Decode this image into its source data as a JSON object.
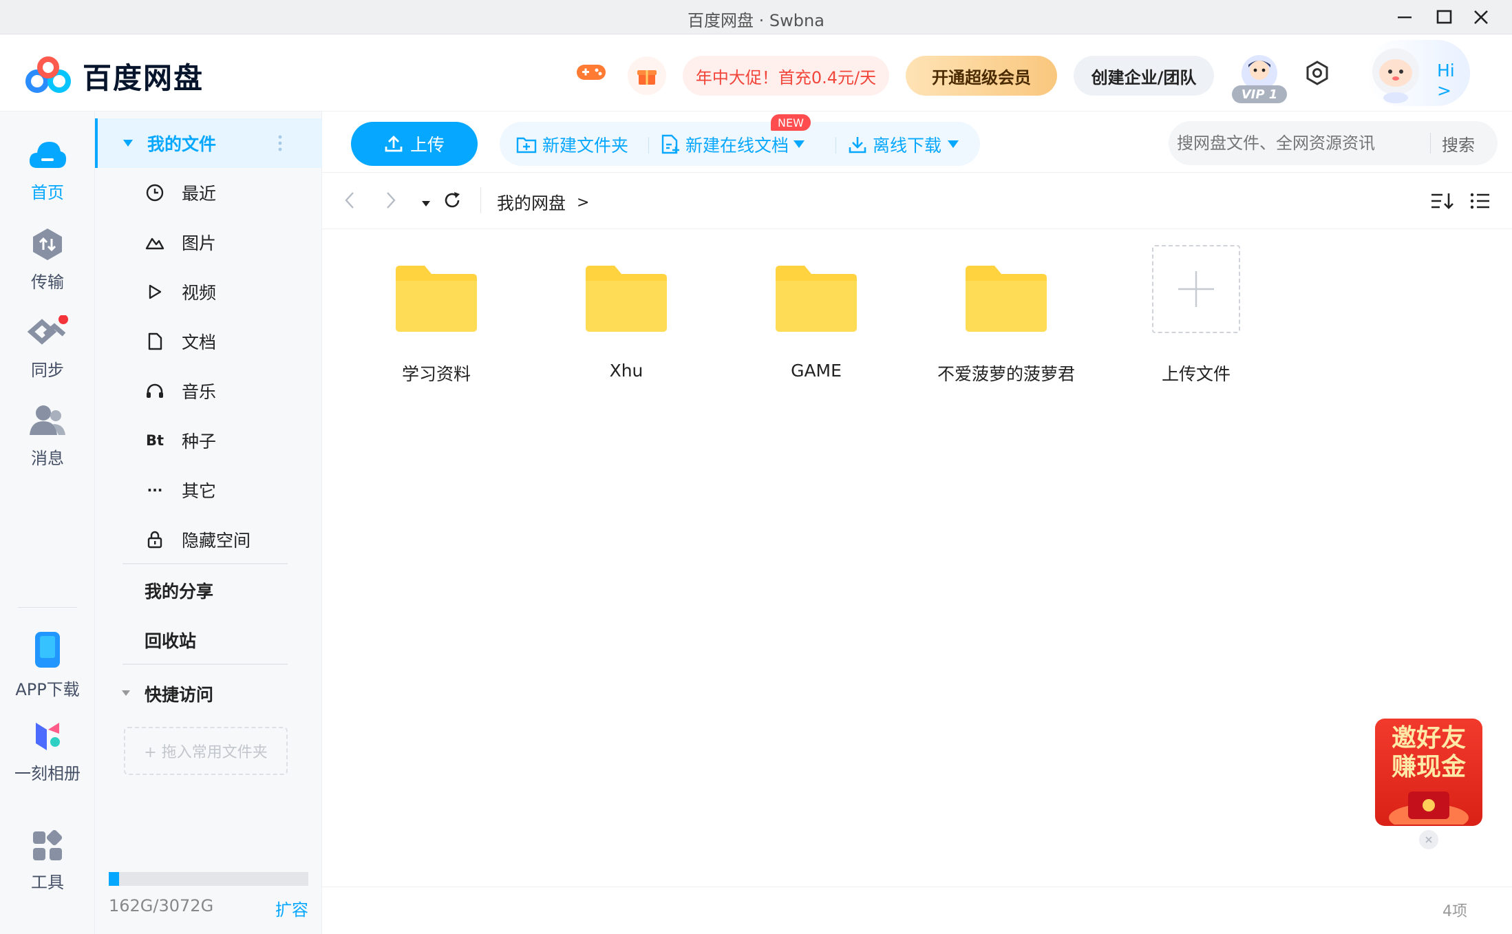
{
  "window": {
    "title": "百度网盘 · Swbna"
  },
  "header": {
    "logo_text": "百度网盘",
    "icons": [
      "gamepad-icon",
      "gift-icon",
      "settings-icon",
      "assistant-avatar"
    ],
    "promo_label": "年中大促！首充0.4元/天",
    "vip_button": "开通超级会员",
    "enterprise_button": "创建企业/团队",
    "vip_badge": "VIP 1",
    "hi_label": "Hi >"
  },
  "rail": {
    "items": [
      {
        "label": "首页",
        "icon": "cloud-icon"
      },
      {
        "label": "传输",
        "icon": "transfer-icon"
      },
      {
        "label": "同步",
        "icon": "sync-icon"
      },
      {
        "label": "消息",
        "icon": "message-icon"
      },
      {
        "label": "APP下载",
        "icon": "phone-icon"
      },
      {
        "label": "一刻相册",
        "icon": "album-icon"
      },
      {
        "label": "工具",
        "icon": "tools-icon"
      }
    ]
  },
  "nav": {
    "my_files": "我的文件",
    "items": [
      {
        "label": "最近",
        "icon": "clock-icon"
      },
      {
        "label": "图片",
        "icon": "image-icon"
      },
      {
        "label": "视频",
        "icon": "play-icon"
      },
      {
        "label": "文档",
        "icon": "document-icon"
      },
      {
        "label": "音乐",
        "icon": "headphones-icon"
      },
      {
        "label": "种子",
        "icon": "bt-icon",
        "icon_text": "Bt"
      },
      {
        "label": "其它",
        "icon": "more-icon",
        "icon_text": "···"
      },
      {
        "label": "隐藏空间",
        "icon": "lock-icon"
      }
    ],
    "my_share": "我的分享",
    "recycle_bin": "回收站",
    "quick_access": "快捷访问",
    "quick_access_placeholder": "+ 拖入常用文件夹",
    "storage_text": "162G/3072G",
    "storage_used_fraction": 0.053,
    "expand_label": "扩容"
  },
  "toolbar": {
    "upload": "上传",
    "new_folder": "新建文件夹",
    "new_doc": "新建在线文档",
    "new_badge": "NEW",
    "offline_download": "离线下载",
    "search_placeholder": "搜网盘文件、全网资源资讯",
    "search_button": "搜索"
  },
  "breadcrumb": {
    "path": "我的网盘",
    "separator": ">"
  },
  "files": [
    {
      "name": "学习资料",
      "type": "folder"
    },
    {
      "name": "Xhu",
      "type": "folder"
    },
    {
      "name": "GAME",
      "type": "folder"
    },
    {
      "name": "不爱菠萝的菠萝君",
      "type": "folder"
    }
  ],
  "upload_tile": "上传文件",
  "promo_card": "邀好友\n赚现金",
  "status": {
    "item_count": "4项"
  },
  "colors": {
    "accent": "#06a7ff",
    "folder": "#ffd340",
    "vip_gold": "#f9c77e",
    "promo_red": "#e8412f"
  }
}
